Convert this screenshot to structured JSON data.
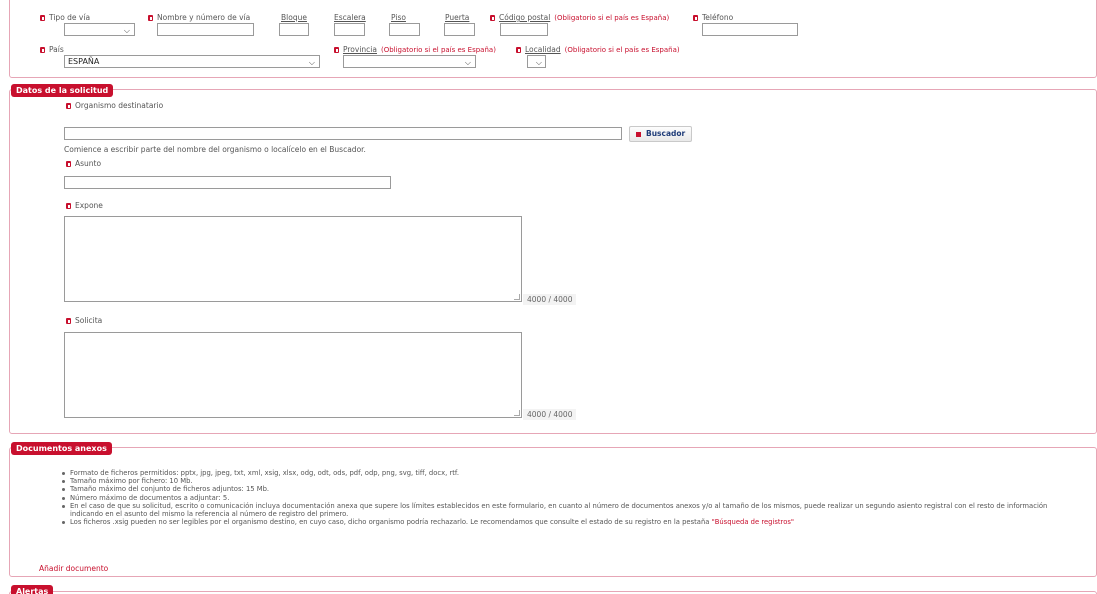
{
  "address": {
    "tipo_via_label": "Tipo de vía",
    "nombre_via_label": "Nombre y número de vía",
    "bloque_label": "Bloque",
    "escalera_label": "Escalera",
    "piso_label": "Piso",
    "puerta_label": "Puerta",
    "codigo_postal_label": "Código postal",
    "codigo_postal_hint": "(Obligatorio si el país es España)",
    "telefono_label": "Teléfono",
    "pais_label": "País",
    "pais_value": "ESPAÑA",
    "provincia_label": "Provincia",
    "provincia_hint": "(Obligatorio si el país es España)",
    "localidad_label": "Localidad",
    "localidad_hint": "(Obligatorio si el país es España)"
  },
  "solicitud": {
    "legend": "Datos de la solicitud",
    "organismo_label": "Organismo destinatario",
    "buscador_label": "Buscador",
    "organismo_help": "Comience a escribir parte del nombre del organismo o localícelo en el Buscador.",
    "asunto_label": "Asunto",
    "expone_label": "Expone",
    "expone_counter": "4000   /  4000",
    "solicita_label": "Solicita",
    "solicita_counter": "4000   /  4000"
  },
  "documentos": {
    "legend": "Documentos anexos",
    "items": [
      "Formato de ficheros permitidos: pptx, jpg, jpeg, txt, xml, xsig, xlsx, odg, odt, ods, pdf, odp, png, svg, tiff, docx, rtf.",
      "Tamaño máximo por fichero: 10 Mb.",
      "Tamaño máximo del conjunto de ficheros adjuntos: 15 Mb.",
      "Número máximo de documentos a adjuntar: 5.",
      "En el caso de que su solicitud, escrito o comunicación incluya documentación anexa que supere los límites establecidos en este formulario, en cuanto al número de documentos anexos y/o al tamaño de los mismos, puede realizar un segundo asiento registral con el resto de información indicando en el asunto del mismo la referencia al número de registro del primero."
    ],
    "xsig_note": "Los ficheros .xsig pueden no ser legibles por el organismo destino, en cuyo caso, dicho organismo podría rechazarlo. Le recomendamos que consulte el estado de su registro en la pestaña ",
    "xsig_link": "\"Búsqueda de registros\"",
    "add_document": "Añadir documento"
  },
  "alertas": {
    "legend": "Alertas"
  }
}
